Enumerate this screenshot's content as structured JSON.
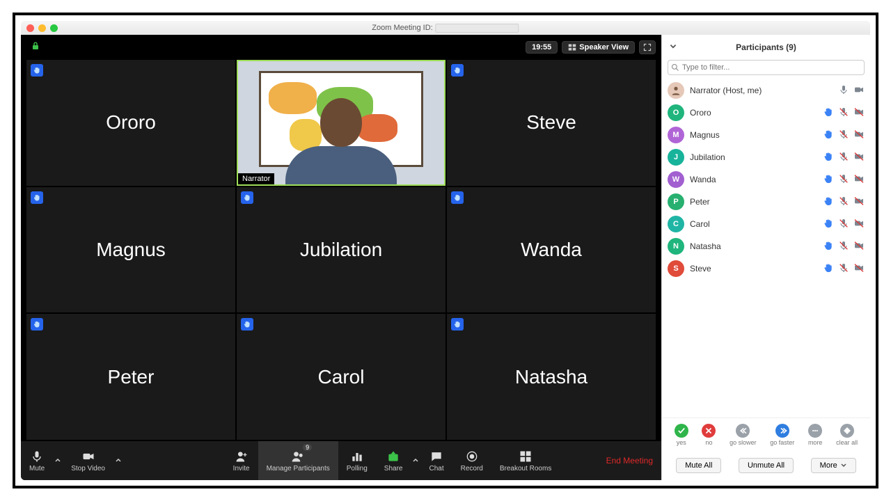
{
  "window": {
    "title_prefix": "Zoom Meeting ID:"
  },
  "topbar": {
    "time": "19:55",
    "view_label": "Speaker View"
  },
  "tiles": [
    {
      "name": "Ororo",
      "hand": true,
      "active": false
    },
    {
      "name": "Narrator",
      "hand": false,
      "active": true
    },
    {
      "name": "Steve",
      "hand": true,
      "active": false
    },
    {
      "name": "Magnus",
      "hand": true,
      "active": false
    },
    {
      "name": "Jubilation",
      "hand": true,
      "active": false
    },
    {
      "name": "Wanda",
      "hand": true,
      "active": false
    },
    {
      "name": "Peter",
      "hand": true,
      "active": false
    },
    {
      "name": "Carol",
      "hand": true,
      "active": false
    },
    {
      "name": "Natasha",
      "hand": true,
      "active": false
    }
  ],
  "bottombar": {
    "mute": "Mute",
    "stop_video": "Stop Video",
    "invite": "Invite",
    "manage": "Manage Participants",
    "manage_count": "9",
    "polling": "Polling",
    "share": "Share",
    "chat": "Chat",
    "record": "Record",
    "breakout": "Breakout Rooms",
    "end": "End Meeting"
  },
  "panel": {
    "title": "Participants (9)",
    "filter_placeholder": "Type to filter...",
    "list": [
      {
        "name": "Narrator (Host, me)",
        "initial": "",
        "color": "#d99",
        "photo": true,
        "hand": false,
        "mic": "on",
        "cam": "on"
      },
      {
        "name": "Ororo",
        "initial": "O",
        "color": "#1fb57c",
        "hand": true,
        "mic": "off",
        "cam": "off"
      },
      {
        "name": "Magnus",
        "initial": "M",
        "color": "#b065d6",
        "hand": true,
        "mic": "off",
        "cam": "off"
      },
      {
        "name": "Jubilation",
        "initial": "J",
        "color": "#17b39a",
        "hand": true,
        "mic": "off",
        "cam": "off"
      },
      {
        "name": "Wanda",
        "initial": "W",
        "color": "#a15fd0",
        "hand": true,
        "mic": "off",
        "cam": "off"
      },
      {
        "name": "Peter",
        "initial": "P",
        "color": "#27b06f",
        "hand": true,
        "mic": "off",
        "cam": "off"
      },
      {
        "name": "Carol",
        "initial": "C",
        "color": "#1fb5a5",
        "hand": true,
        "mic": "off",
        "cam": "off"
      },
      {
        "name": "Natasha",
        "initial": "N",
        "color": "#1fb57c",
        "hand": true,
        "mic": "off",
        "cam": "off"
      },
      {
        "name": "Steve",
        "initial": "S",
        "color": "#e04b3a",
        "hand": true,
        "mic": "off",
        "cam": "off"
      }
    ],
    "reactions": [
      {
        "label": "yes",
        "color": "#2fb54a"
      },
      {
        "label": "no",
        "color": "#e03c3c"
      },
      {
        "label": "go slower",
        "color": "#9aa1a8"
      },
      {
        "label": "go faster",
        "color": "#2f7de0"
      },
      {
        "label": "more",
        "color": "#9aa1a8"
      },
      {
        "label": "clear all",
        "color": "#9aa1a8"
      }
    ],
    "buttons": {
      "mute_all": "Mute All",
      "unmute_all": "Unmute All",
      "more": "More"
    }
  }
}
